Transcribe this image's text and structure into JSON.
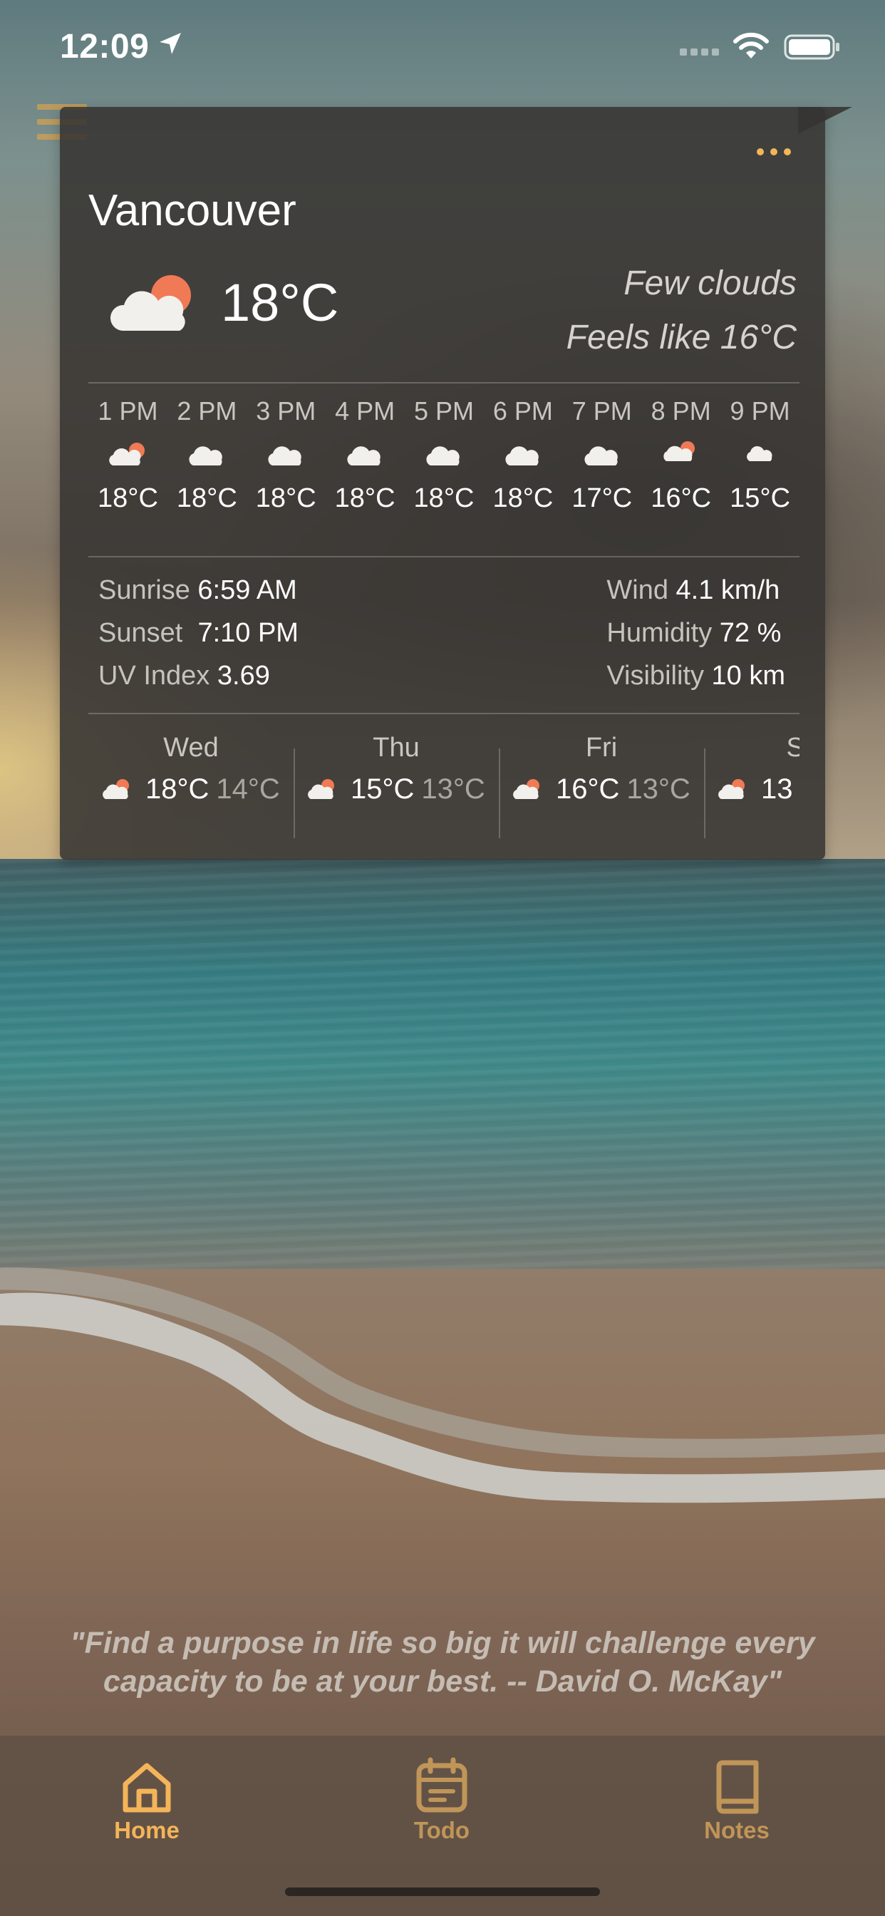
{
  "status_bar": {
    "time": "12:09",
    "icons": [
      "location-arrow-icon",
      "cellular-signal-icon",
      "wifi-icon",
      "battery-icon"
    ]
  },
  "menu": {
    "icon": "hamburger-menu-icon",
    "color": "#e2a445"
  },
  "weather": {
    "city": "Vancouver",
    "current_temp": "18°C",
    "current_icon": "partly-cloudy-icon",
    "condition": "Few clouds",
    "feels_like": "Feels like 16°C",
    "more_icon": "more-dots-icon",
    "hourly": [
      {
        "time": "1 PM",
        "temp": "18°C",
        "icon": "partly-cloudy-icon"
      },
      {
        "time": "2 PM",
        "temp": "18°C",
        "icon": "cloud-icon"
      },
      {
        "time": "3 PM",
        "temp": "18°C",
        "icon": "cloud-icon"
      },
      {
        "time": "4 PM",
        "temp": "18°C",
        "icon": "cloud-icon"
      },
      {
        "time": "5 PM",
        "temp": "18°C",
        "icon": "cloud-icon"
      },
      {
        "time": "6 PM",
        "temp": "18°C",
        "icon": "cloud-icon"
      },
      {
        "time": "7 PM",
        "temp": "17°C",
        "icon": "cloud-icon"
      },
      {
        "time": "8 PM",
        "temp": "16°C",
        "icon": "partly-cloudy-icon"
      },
      {
        "time": "9 PM",
        "temp": "15°C",
        "icon": "cloud-icon"
      }
    ],
    "details": {
      "sunrise_label": "Sunrise",
      "sunrise": "6:59 AM",
      "sunset_label": "Sunset",
      "sunset": "7:10 PM",
      "uv_label": "UV Index",
      "uv": "3.69",
      "wind_label": "Wind",
      "wind": "4.1 km/h",
      "humidity_label": "Humidity",
      "humidity": "72 %",
      "visibility_label": "Visibility",
      "visibility": "10 km"
    },
    "daily": [
      {
        "day": "Wed",
        "high": "18°C",
        "low": "14°C",
        "icon": "partly-cloudy-icon"
      },
      {
        "day": "Thu",
        "high": "15°C",
        "low": "13°C",
        "icon": "partly-cloudy-icon"
      },
      {
        "day": "Fri",
        "high": "16°C",
        "low": "13°C",
        "icon": "partly-cloudy-icon"
      },
      {
        "day": "Sat",
        "high": "13",
        "low": "",
        "icon": "partly-cloudy-icon"
      }
    ]
  },
  "quote": "\"Find a purpose in life so big it will challenge every capacity to be at your best. -- David O. McKay\"",
  "tabs": [
    {
      "label": "Home",
      "icon": "home-icon",
      "active": true
    },
    {
      "label": "Todo",
      "icon": "calendar-icon",
      "active": false
    },
    {
      "label": "Notes",
      "icon": "book-icon",
      "active": false
    }
  ],
  "colors": {
    "accent": "#f4b459",
    "accent_muted": "#c09558",
    "card_bg": "#373432",
    "sun": "#f07a55"
  }
}
